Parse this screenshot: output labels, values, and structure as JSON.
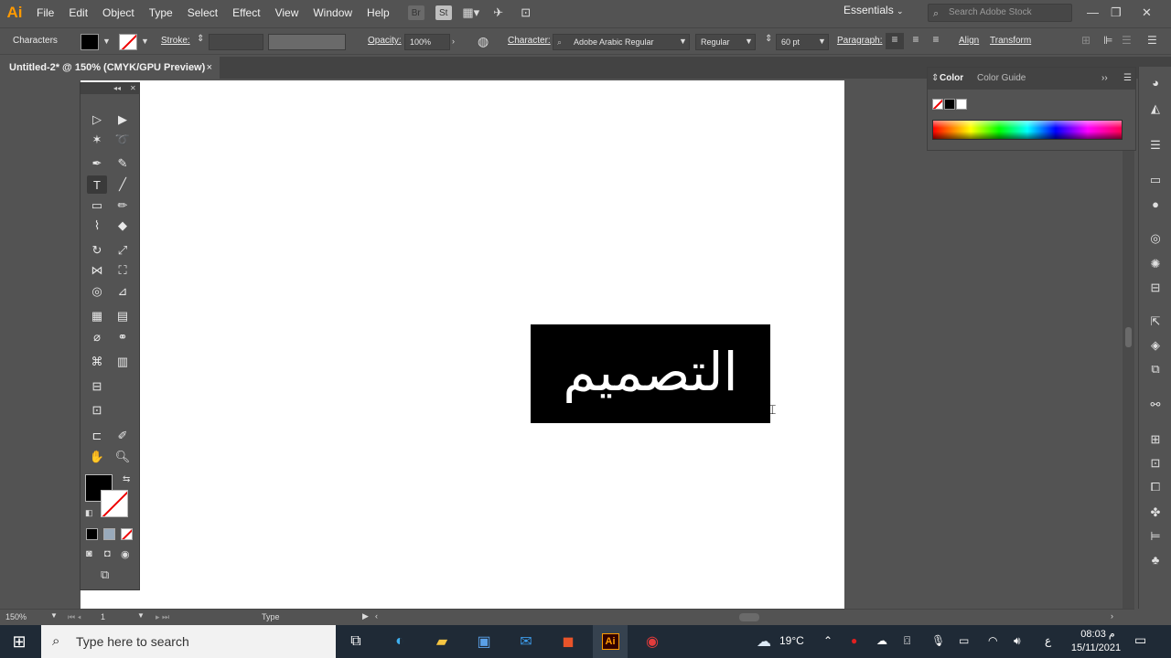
{
  "app": {
    "logo": "Ai"
  },
  "menu": [
    "File",
    "Edit",
    "Object",
    "Type",
    "Select",
    "Effect",
    "View",
    "Window",
    "Help"
  ],
  "menubar_icons": [
    "Br",
    "St"
  ],
  "workspace": "Essentials",
  "stock_search": {
    "placeholder": "Search Adobe Stock"
  },
  "control_bar": {
    "panel_name": "Characters",
    "stroke_label": "Stroke:",
    "opacity_label": "Opacity:",
    "opacity_value": "100%",
    "character_label": "Character:",
    "font_family": "Adobe Arabic Regular",
    "font_style": "Regular",
    "font_size": "60 pt",
    "paragraph_label": "Paragraph:",
    "align_label": "Align",
    "transform_label": "Transform"
  },
  "document_tab": {
    "title": "Untitled-2* @ 150% (CMYK/GPU Preview)",
    "close": "×"
  },
  "artboard_text": "التصميم",
  "color_panel": {
    "tab_color": "Color",
    "tab_guide": "Color Guide"
  },
  "status": {
    "zoom": "150%",
    "artboard": "1",
    "tool": "Type"
  },
  "taskbar": {
    "search_placeholder": "Type here to search",
    "weather": "19°C",
    "lang": "ع",
    "time": "08:03 م",
    "date": "15/11/2021"
  },
  "colors": {
    "accent_ai": "#ff9a00",
    "ui_bg": "#535353",
    "taskbar": "#1f2a36"
  }
}
